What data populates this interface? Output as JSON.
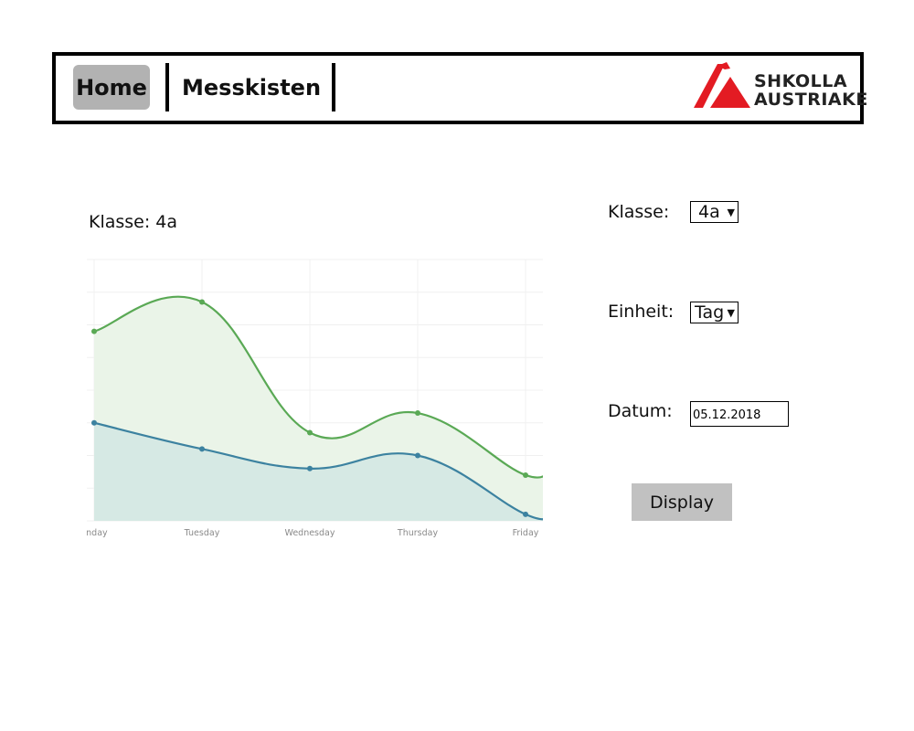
{
  "nav": {
    "home_label": "Home",
    "messkisten_label": "Messkisten"
  },
  "logo": {
    "line1": "SHKOLLA",
    "line2": "AUSTRIAKE",
    "color": "#e31b23"
  },
  "chart_title": "Klasse: 4a",
  "form": {
    "klasse_label": "Klasse:",
    "klasse_value": "4a",
    "einheit_label": "Einheit:",
    "einheit_value": "Tag",
    "datum_label": "Datum:",
    "datum_value": "05.12.2018",
    "display_label": "Display"
  },
  "chart_data": {
    "type": "area",
    "categories": [
      "Monday",
      "Tuesday",
      "Wednesday",
      "Thursday",
      "Friday"
    ],
    "tick_labels_visible": [
      "onday",
      "Tuesday",
      "Wednesday",
      "Thursday",
      "Friday"
    ],
    "ylim": [
      0,
      8
    ],
    "grid": true,
    "series": [
      {
        "color": "#5aa955",
        "fill": "#eaf4e8",
        "values": [
          5.8,
          6.7,
          2.7,
          3.3,
          1.4
        ]
      },
      {
        "color": "#3c82a0",
        "fill": "#d6e9e4",
        "values": [
          3.0,
          2.2,
          1.6,
          2.0,
          0.2
        ]
      }
    ]
  }
}
